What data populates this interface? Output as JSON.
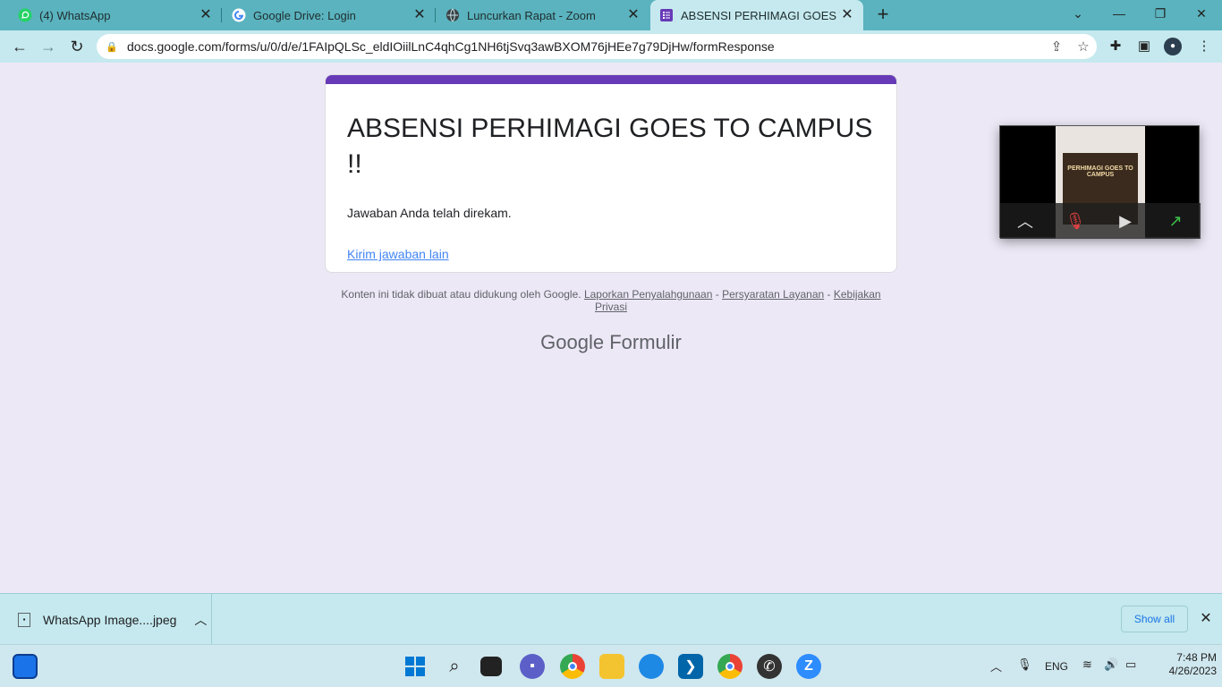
{
  "tabs": [
    {
      "title": "(4) WhatsApp",
      "icon": "whatsapp-icon",
      "active": false
    },
    {
      "title": "Google Drive: Login",
      "icon": "google-icon",
      "active": false
    },
    {
      "title": "Luncurkan Rapat - Zoom",
      "icon": "globe-icon",
      "active": false
    },
    {
      "title": "ABSENSI PERHIMAGI GOES TO C",
      "icon": "forms-icon",
      "active": true
    }
  ],
  "address_bar": {
    "url": "docs.google.com/forms/u/0/d/e/1FAIpQLSc_eldIOiilLnC4qhCg1NH6tjSvq3awBXOM76jHEe7g79DjHw/formResponse"
  },
  "form": {
    "title": "ABSENSI PERHIMAGI GOES TO CAMPUS !!",
    "message": "Jawaban Anda telah direkam.",
    "resubmit_link": "Kirim jawaban lain",
    "accent_color": "#673ab7"
  },
  "footer": {
    "disclaimer": "Konten ini tidak dibuat atau didukung oleh Google.",
    "report_link": "Laporkan Penyalahgunaan",
    "terms_link": "Persyaratan Layanan",
    "privacy_link": "Kebijakan Privasi",
    "separator": "-",
    "brand_google": "Google",
    "brand_product": "Formulir"
  },
  "zoom_overlay": {
    "poster_text": "PERHIMAGI GOES TO CAMPUS"
  },
  "download_bar": {
    "file_name": "WhatsApp Image....jpeg",
    "show_all_label": "Show all"
  },
  "taskbar": {
    "language": "ENG",
    "time": "7:48 PM",
    "date": "4/26/2023"
  }
}
